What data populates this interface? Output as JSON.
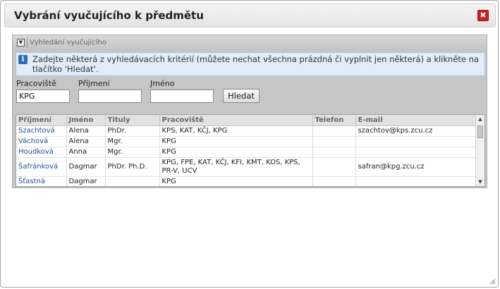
{
  "dialog": {
    "title": "Vybrání vyučujícího k předmětu",
    "close_icon": "✖"
  },
  "search_panel": {
    "title": "Vyhledání vyučujícího",
    "collapse_icon": "▼",
    "info_text": "Zadejte některá z vyhledávacích kritérií (můžete nechat všechna prázdná či vyplnit jen některá) a klikněte na tlačítko 'Hledat'.",
    "info_icon": "i",
    "fields": {
      "pracoviste_label": "Pracoviště",
      "pracoviste_value": "KPG",
      "prijmeni_label": "Příjmení",
      "prijmeni_value": "",
      "jmeno_label": "Jméno",
      "jmeno_value": ""
    },
    "search_button": "Hledat"
  },
  "results": {
    "columns": [
      "Příjmení",
      "Jméno",
      "Tituly",
      "Pracoviště",
      "Telefon",
      "E-mail"
    ],
    "rows": [
      {
        "surname": "Szachtová",
        "name": "Alena",
        "titles": "PhDr.",
        "workplace": "KPS, KAT, KČJ, KPG",
        "phone": "",
        "email": "szachtov@kps.zcu.cz"
      },
      {
        "surname": "Váchová",
        "name": "Alena",
        "titles": "Mgr.",
        "workplace": "KPG",
        "phone": "",
        "email": ""
      },
      {
        "surname": "Houdková",
        "name": "Anna",
        "titles": "Mgr.",
        "workplace": "KPG",
        "phone": "",
        "email": ""
      },
      {
        "surname": "Šafránková",
        "name": "Dagmar",
        "titles": "PhDr. Ph.D.",
        "workplace": "KPG, FPE, KAT, KČJ, KFI, KMT, KOS, KPS, PR-V, UCV",
        "phone": "",
        "email": "safran@kpg.zcu.cz"
      },
      {
        "surname": "Šťastná",
        "name": "Dagmar",
        "titles": "",
        "workplace": "KPG",
        "phone": "",
        "email": ""
      }
    ],
    "scroll_up_icon": "▲",
    "scroll_down_icon": "▼"
  },
  "colors": {
    "link": "#1f4e96",
    "close_button": "#cc2222",
    "info_background": "#e1ecf8",
    "panel_background": "#c6c6c6"
  }
}
